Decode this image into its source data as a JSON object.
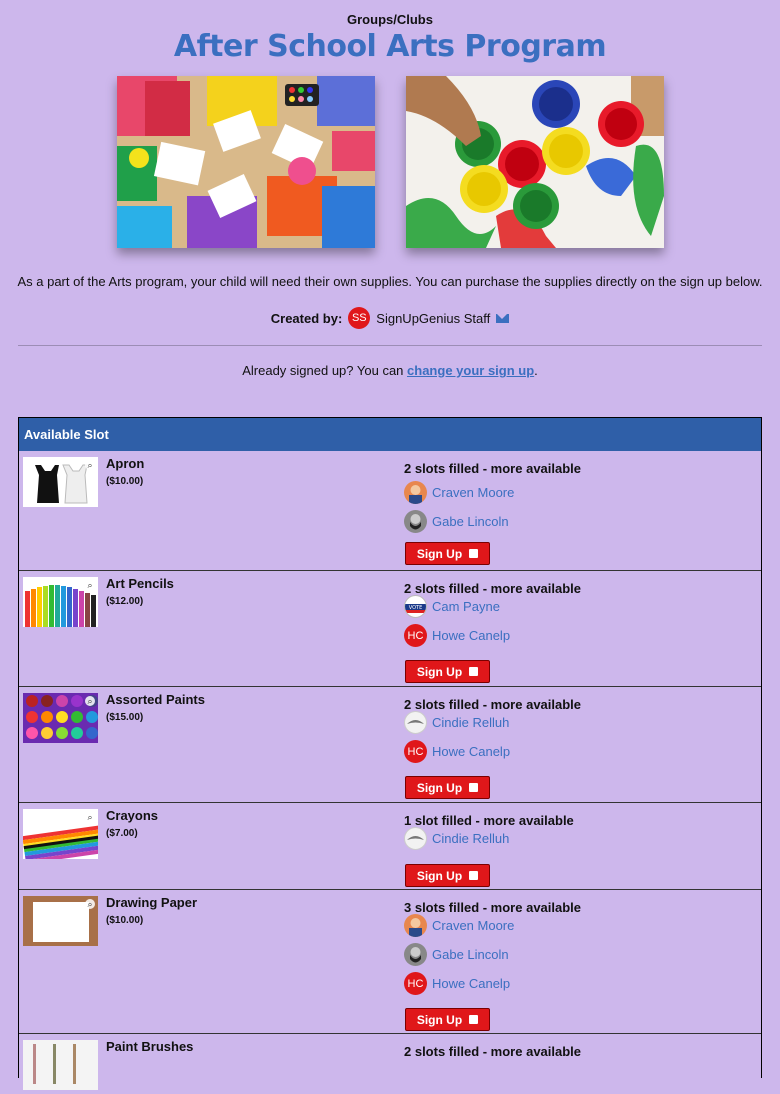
{
  "header": {
    "category": "Groups/Clubs",
    "title": "After School Arts Program"
  },
  "description": "As a part of the Arts program, your child will need their own supplies. You can purchase the supplies directly on the sign up below.",
  "creator": {
    "label": "Created by:",
    "initials": "SS",
    "name": "SignUpGenius Staff"
  },
  "already": {
    "text": "Already signed up? You can",
    "link": "change your sign up",
    "suffix": "."
  },
  "table": {
    "header": "Available Slot",
    "signup_label": "Sign Up",
    "rows": [
      {
        "name": "Apron",
        "price": "($10.00)",
        "status": "2 slots filled - more available",
        "signees": [
          {
            "name": "Craven Moore",
            "initials": ""
          },
          {
            "name": "Gabe Lincoln",
            "initials": ""
          }
        ]
      },
      {
        "name": "Art Pencils",
        "price": "($12.00)",
        "status": "2 slots filled - more available",
        "signees": [
          {
            "name": "Cam Payne",
            "initials": "VOTE"
          },
          {
            "name": "Howe Canelp",
            "initials": "HC"
          }
        ]
      },
      {
        "name": "Assorted Paints",
        "price": "($15.00)",
        "status": "2 slots filled - more available",
        "signees": [
          {
            "name": "Cindie Relluh",
            "initials": ""
          },
          {
            "name": "Howe Canelp",
            "initials": "HC"
          }
        ]
      },
      {
        "name": "Crayons",
        "price": "($7.00)",
        "status": "1 slot filled - more available",
        "signees": [
          {
            "name": "Cindie Relluh",
            "initials": ""
          }
        ]
      },
      {
        "name": "Drawing Paper",
        "price": "($10.00)",
        "status": "3 slots filled - more available",
        "signees": [
          {
            "name": "Craven Moore",
            "initials": ""
          },
          {
            "name": "Gabe Lincoln",
            "initials": ""
          },
          {
            "name": "Howe Canelp",
            "initials": "HC"
          }
        ]
      },
      {
        "name": "Paint Brushes",
        "price": "",
        "status": "2 slots filled - more available",
        "signees": []
      }
    ]
  }
}
